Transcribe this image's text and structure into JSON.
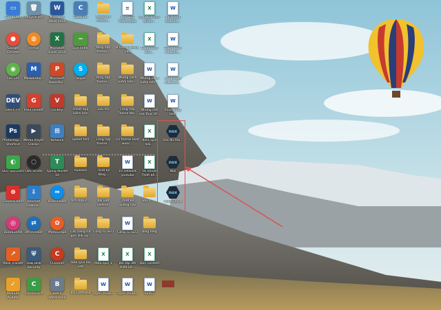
{
  "desktop": {
    "icons": [
      {
        "label": "Computer",
        "glyph": "computer-icon",
        "sym": "▭",
        "color": "#3a7bd5",
        "shape": "box",
        "col": 0,
        "row": 0
      },
      {
        "label": "Google Chrome",
        "glyph": "chrome-icon",
        "sym": "●",
        "color": "#e94b3c",
        "shape": "round",
        "col": 0,
        "row": 1
      },
      {
        "label": "Cốc Cốc",
        "glyph": "coccoc-icon",
        "sym": "◉",
        "color": "#5fb34a",
        "shape": "round",
        "col": 0,
        "row": 2
      },
      {
        "label": "Dev-C++",
        "glyph": "devcpp-icon",
        "sym": "DEV",
        "color": "#2f4d7a",
        "shape": "box",
        "col": 0,
        "row": 3
      },
      {
        "label": "Photoshop... - Shortcut",
        "glyph": "photoshop-icon",
        "sym": "Ps",
        "color": "#1b3a63",
        "shape": "box",
        "col": 0,
        "row": 4
      },
      {
        "label": "SEO SpyGlass",
        "glyph": "seo-spyglass-icon",
        "sym": "◐",
        "color": "#3aa84a",
        "shape": "box",
        "col": 0,
        "row": 5
      },
      {
        "label": "LinkAssistant",
        "glyph": "linkassistant-icon",
        "sym": "⊕",
        "color": "#d9302c",
        "shape": "box",
        "col": 0,
        "row": 6
      },
      {
        "label": "BuzzBundle",
        "glyph": "buzzbundle-icon",
        "sym": "◎",
        "color": "#d63a7a",
        "shape": "round",
        "col": 0,
        "row": 7
      },
      {
        "label": "Rank Tracker",
        "glyph": "rank-tracker-icon",
        "sym": "↗",
        "color": "#e26024",
        "shape": "box",
        "col": 0,
        "row": 8
      },
      {
        "label": "WebSite Auditor",
        "glyph": "website-auditor-icon",
        "sym": "✓",
        "color": "#e8a02a",
        "shape": "box",
        "col": 0,
        "row": 9
      },
      {
        "label": "Recycle Bin",
        "glyph": "recycle-bin-icon",
        "sym": "🗑",
        "color": "#6f8fa8",
        "shape": "box",
        "col": 1,
        "row": 0
      },
      {
        "label": "Firefox",
        "glyph": "firefox-icon",
        "sym": "◍",
        "color": "#f08a24",
        "shape": "round",
        "col": 1,
        "row": 1
      },
      {
        "label": "Malwareby...",
        "glyph": "malwarebytes-icon",
        "sym": "M",
        "color": "#2a5fb0",
        "shape": "box",
        "col": 1,
        "row": 2
      },
      {
        "label": "Foxit Reader",
        "glyph": "foxit-icon",
        "sym": "G",
        "color": "#d6402c",
        "shape": "box",
        "col": 1,
        "row": 3
      },
      {
        "label": "Media Player Classic",
        "glyph": "media-player-icon",
        "sym": "▶",
        "color": "#3a4a5c",
        "shape": "box",
        "col": 1,
        "row": 4
      },
      {
        "label": "OBS Studio",
        "glyph": "obs-icon",
        "sym": "◌",
        "color": "#2b2b2b",
        "shape": "round",
        "col": 1,
        "row": 5
      },
      {
        "label": "Internet Downlo...",
        "glyph": "idm-icon",
        "sym": "⇩",
        "color": "#2f7dc6",
        "shape": "box",
        "col": 1,
        "row": 6
      },
      {
        "label": "UltraViewer",
        "glyph": "ultraviewer-icon",
        "sym": "⇄",
        "color": "#1e6fb8",
        "shape": "round",
        "col": 1,
        "row": 7
      },
      {
        "label": "USB Disk Security",
        "glyph": "usb-disk-icon",
        "sym": "⛨",
        "color": "#3c5a7a",
        "shape": "box",
        "col": 1,
        "row": 8
      },
      {
        "label": "Camtasia 9",
        "glyph": "camtasia-icon",
        "sym": "C",
        "color": "#3d9b46",
        "shape": "box",
        "col": 1,
        "row": 9
      },
      {
        "label": "Microsoft Word 2010",
        "glyph": "word-icon",
        "sym": "W",
        "color": "#2b579a",
        "shape": "box",
        "col": 2,
        "row": 0
      },
      {
        "label": "Microsoft Excel 2010",
        "glyph": "excel-icon",
        "sym": "X",
        "color": "#217346",
        "shape": "box",
        "col": 2,
        "row": 1
      },
      {
        "label": "Microsoft PowerPoi...",
        "glyph": "powerpoint-icon",
        "sym": "P",
        "color": "#d24726",
        "shape": "box",
        "col": 2,
        "row": 2
      },
      {
        "label": "UniKey",
        "glyph": "unikey-icon",
        "sym": "V",
        "color": "#c0392b",
        "shape": "box",
        "col": 2,
        "row": 3
      },
      {
        "label": "Network",
        "glyph": "network-icon",
        "sym": "⊞",
        "color": "#3d7fc1",
        "shape": "box",
        "col": 2,
        "row": 4
      },
      {
        "label": "Typing Master 10",
        "glyph": "typing-master-icon",
        "sym": "T",
        "color": "#2e8b57",
        "shape": "box",
        "col": 2,
        "row": 5
      },
      {
        "label": "TeamViewer",
        "glyph": "teamviewer-icon",
        "sym": "⇔",
        "color": "#0e8ee9",
        "shape": "round",
        "col": 2,
        "row": 6
      },
      {
        "label": "PhotoScape",
        "glyph": "photoscape-icon",
        "sym": "✿",
        "color": "#e85d2a",
        "shape": "round",
        "col": 2,
        "row": 7
      },
      {
        "label": "CCleaner",
        "glyph": "ccleaner-icon",
        "sym": "C",
        "color": "#c23b22",
        "shape": "round",
        "col": 2,
        "row": 8
      },
      {
        "label": "Batch Watermark",
        "glyph": "batch-watermark-icon",
        "sym": "B",
        "color": "#6b7b8c",
        "shape": "box",
        "col": 2,
        "row": 9
      },
      {
        "label": "Caesium",
        "glyph": "caesium-icon",
        "sym": "C",
        "color": "#4a7fb5",
        "shape": "box",
        "col": 3,
        "row": 0
      },
      {
        "label": "LiveTraffic",
        "glyph": "livetraffic-icon",
        "sym": "~",
        "color": "#4f9a3f",
        "shape": "box",
        "col": 3,
        "row": 1
      },
      {
        "label": "Skype",
        "glyph": "skype-icon",
        "sym": "S",
        "color": "#00aff0",
        "shape": "round",
        "col": 3,
        "row": 2
      },
      {
        "label": "cheat app kiếm tiền",
        "glyph": "cheat-app-icon",
        "sym": "",
        "color": "#f0c458",
        "shape": "folder",
        "col": 3,
        "row": 3
      },
      {
        "label": "Speed test",
        "glyph": "speed-test-icon",
        "sym": "",
        "color": "#f0c458",
        "shape": "folder",
        "col": 3,
        "row": 4
      },
      {
        "label": "Aiolearn",
        "glyph": "aiolearn-icon",
        "sym": "",
        "color": "#f0c458",
        "shape": "folder",
        "col": 3,
        "row": 5
      },
      {
        "label": "tích-hợp-c...",
        "glyph": "folder-icon",
        "sym": "",
        "color": "#f0c458",
        "shape": "folder",
        "col": 3,
        "row": 6
      },
      {
        "label": "Các hàng rút gọn link uy...",
        "glyph": "folder-icon",
        "sym": "",
        "color": "#f0c458",
        "shape": "folder",
        "col": 3,
        "row": 7
      },
      {
        "label": "data spin bài viết",
        "glyph": "folder-icon",
        "sym": "",
        "color": "#f0c458",
        "shape": "folder",
        "col": 3,
        "row": 8
      },
      {
        "label": "kq-Camtasia",
        "glyph": "folder-icon",
        "sym": "",
        "color": "#f0c458",
        "shape": "folder",
        "col": 3,
        "row": 9
      },
      {
        "label": "tổng hợp theme...",
        "glyph": "folder-icon",
        "sym": "",
        "color": "#f0c458",
        "shape": "folder",
        "col": 4,
        "row": 0
      },
      {
        "label": "tổng hợp theme...",
        "glyph": "folder-icon",
        "sym": "",
        "color": "#f0c458",
        "shape": "folder",
        "col": 4,
        "row": 1
      },
      {
        "label": "tổng hợp theme...",
        "glyph": "folder-icon",
        "sym": "",
        "color": "#f0c458",
        "shape": "folder",
        "col": 4,
        "row": 2
      },
      {
        "label": "Lưu trữ",
        "glyph": "folder-icon",
        "sym": "",
        "color": "#f0c458",
        "shape": "folder",
        "col": 4,
        "row": 3
      },
      {
        "label": "Tổng hợp theme...",
        "glyph": "folder-icon",
        "sym": "",
        "color": "#f0c458",
        "shape": "folder",
        "col": 4,
        "row": 4
      },
      {
        "label": "Thiết kế Blog...",
        "glyph": "folder-icon",
        "sym": "",
        "color": "#f0c458",
        "shape": "folder",
        "col": 4,
        "row": 5
      },
      {
        "label": "bài viết aioleam",
        "glyph": "folder-icon",
        "sym": "",
        "color": "#f0c458",
        "shape": "folder",
        "col": 4,
        "row": 6
      },
      {
        "label": "Công cụ SEO",
        "glyph": "folder-icon",
        "sym": "",
        "color": "#f0c458",
        "shape": "folder",
        "col": 4,
        "row": 7
      },
      {
        "label": "data spin 1",
        "glyph": "excel-file-icon",
        "sym": "X",
        "color": "#1d7a3d",
        "shape": "xls",
        "col": 4,
        "row": 8
      },
      {
        "label": "Tuyển thiếp...",
        "glyph": "word-file-icon",
        "sym": "W",
        "color": "#1e4fa8",
        "shape": "doc",
        "col": 4,
        "row": 9
      },
      {
        "label": "key SEO Powersuite",
        "glyph": "doc-file-icon",
        "sym": "≡",
        "color": "#ffffff",
        "shape": "doc",
        "col": 5,
        "row": 0
      },
      {
        "label": "8 mạng quảng cáo",
        "glyph": "folder-icon",
        "sym": "",
        "color": "#f0c458",
        "shape": "folder",
        "col": 5,
        "row": 1
      },
      {
        "label": "Những cách kiếm tiền...",
        "glyph": "folder-icon",
        "sym": "",
        "color": "#f0c458",
        "shape": "folder",
        "col": 5,
        "row": 2
      },
      {
        "label": "Tổng hợp Theme Wo...",
        "glyph": "folder-icon",
        "sym": "",
        "color": "#f0c458",
        "shape": "folder",
        "col": 5,
        "row": 3
      },
      {
        "label": "10 theme best wooc...",
        "glyph": "folder-icon",
        "sym": "",
        "color": "#f0c458",
        "shape": "folder",
        "col": 5,
        "row": 4
      },
      {
        "label": "10 network youtube",
        "glyph": "word-file-icon",
        "sym": "W",
        "color": "#1e4fa8",
        "shape": "doc",
        "col": 5,
        "row": 5
      },
      {
        "label": "Thiết kế quảng cáo",
        "glyph": "folder-icon",
        "sym": "",
        "color": "#f0c458",
        "shape": "folder",
        "col": 5,
        "row": 6
      },
      {
        "label": "Công cụ SEO",
        "glyph": "word-file-icon",
        "sym": "W",
        "color": "#1e4fa8",
        "shape": "doc",
        "col": 5,
        "row": 7
      },
      {
        "label": "Bài tập lớn thiết kế...",
        "glyph": "excel-file-icon",
        "sym": "X",
        "color": "#1d7a3d",
        "shape": "xls",
        "col": 5,
        "row": 8
      },
      {
        "label": "Tuyển thiếp...",
        "glyph": "word-file-icon",
        "sym": "W",
        "color": "#1e4fa8",
        "shape": "doc",
        "col": 5,
        "row": 9
      },
      {
        "label": "key-đủ-4-sản-phẩm...",
        "glyph": "excel-file-icon",
        "sym": "X",
        "color": "#1d7a3d",
        "shape": "xls",
        "col": 6,
        "row": 0
      },
      {
        "label": "Danh sách tiền...",
        "glyph": "excel-file-icon",
        "sym": "X",
        "color": "#1d7a3d",
        "shape": "xls",
        "col": 6,
        "row": 1
      },
      {
        "label": "Những cách kiếm tiền...",
        "glyph": "word-file-icon",
        "sym": "W",
        "color": "#1e4fa8",
        "shape": "doc",
        "col": 6,
        "row": 2
      },
      {
        "label": "Những lĩnh vực thực tế...",
        "glyph": "word-file-icon",
        "sym": "W",
        "color": "#1e4fa8",
        "shape": "doc",
        "col": 6,
        "row": 3
      },
      {
        "label": "data spin bài...",
        "glyph": "excel-file-icon",
        "sym": "X",
        "color": "#1d7a3d",
        "shape": "xls",
        "col": 6,
        "row": 4
      },
      {
        "label": "Tài khoản Thiết kế...",
        "glyph": "excel-file-icon",
        "sym": "X",
        "color": "#1d7a3d",
        "shape": "xls",
        "col": 6,
        "row": 5
      },
      {
        "label": "Bài 1 - ...",
        "glyph": "folder-icon",
        "sym": "",
        "color": "#f0c458",
        "shape": "folder",
        "col": 6,
        "row": 6
      },
      {
        "label": "blog blog",
        "glyph": "folder-icon",
        "sym": "",
        "color": "#f0c458",
        "shape": "folder",
        "col": 6,
        "row": 7
      },
      {
        "label": "spin content ...",
        "glyph": "excel-file-icon",
        "sym": "X",
        "color": "#1d7a3d",
        "shape": "xls",
        "col": 6,
        "row": 8
      },
      {
        "label": "hình...",
        "glyph": "word-file-icon",
        "sym": "W",
        "color": "#1e4fa8",
        "shape": "doc",
        "col": 6,
        "row": 9
      },
      {
        "label": "hệ thống website...",
        "glyph": "word-file-icon",
        "sym": "W",
        "color": "#1e4fa8",
        "shape": "doc",
        "col": 7,
        "row": 0
      },
      {
        "label": "Danh sách website...",
        "glyph": "word-file-icon",
        "sym": "W",
        "color": "#1e4fa8",
        "shape": "doc",
        "col": 7,
        "row": 1
      },
      {
        "label": "nối google adsense...",
        "glyph": "word-file-icon",
        "sym": "W",
        "color": "#1e4fa8",
        "shape": "doc",
        "col": 7,
        "row": 2
      },
      {
        "label": "mùa-đông-lạnh",
        "glyph": "word-file-icon",
        "sym": "W",
        "color": "#1e4fa8",
        "shape": "doc",
        "col": 7,
        "row": 3
      },
      {
        "label": "nox-đủ-tho...",
        "glyph": "nox-icon",
        "sym": "nox",
        "color": "#1e2b3a",
        "shape": "nox",
        "col": 7,
        "row": 4
      },
      {
        "label": "Nox",
        "glyph": "nox-icon",
        "sym": "nox",
        "color": "#1e2b3a",
        "shape": "nox",
        "col": 7,
        "row": 5
      },
      {
        "label": "Multi-Drive",
        "glyph": "nox-multi-drive-icon",
        "sym": "nox",
        "color": "#1e2b3a",
        "shape": "nox",
        "col": 7,
        "row": 6
      }
    ]
  }
}
